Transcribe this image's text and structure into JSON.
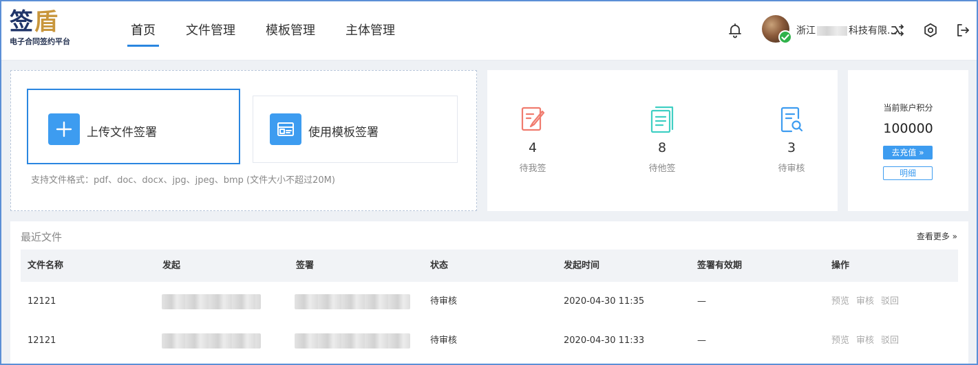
{
  "header": {
    "logo_main_1": "签",
    "logo_main_2": "盾",
    "logo_sub": "电子合同签约平台",
    "nav": [
      {
        "label": "首页",
        "active": true
      },
      {
        "label": "文件管理"
      },
      {
        "label": "模板管理"
      },
      {
        "label": "主体管理"
      }
    ],
    "company_prefix": "浙江",
    "company_suffix": "科技有限...",
    "icons": [
      "bell-icon",
      "switch-icon",
      "settings-icon",
      "logout-icon"
    ]
  },
  "upload": {
    "upload_label": "上传文件签署",
    "template_label": "使用模板签署",
    "hint": "支持文件格式：pdf、doc、docx、jpg、jpeg、bmp (文件大小不超过20M)"
  },
  "stats": [
    {
      "value": "4",
      "label": "待我签",
      "color": "#f07b6e"
    },
    {
      "value": "8",
      "label": "待他签",
      "color": "#3fcfc3"
    },
    {
      "value": "3",
      "label": "待审核",
      "color": "#3d9cf0"
    }
  ],
  "points": {
    "title": "当前账户积分",
    "value": "100000",
    "recharge_label": "去充值 »",
    "detail_label": "明细"
  },
  "recent": {
    "title": "最近文件",
    "more_label": "查看更多 »",
    "columns": [
      "文件名称",
      "发起",
      "签署",
      "状态",
      "发起时间",
      "签署有效期",
      "操作"
    ],
    "rows": [
      {
        "name": "12121",
        "status": "待审核",
        "time": "2020-04-30 11:35",
        "validity": "—",
        "ops": [
          "预览",
          "审核",
          "驳回"
        ]
      },
      {
        "name": "12121",
        "status": "待审核",
        "time": "2020-04-30 11:33",
        "validity": "—",
        "ops": [
          "预览",
          "审核",
          "驳回"
        ]
      }
    ]
  },
  "colors": {
    "accent": "#2a86e0",
    "button_blue": "#3d9cf0",
    "brand_navy": "#1f3468",
    "brand_gold": "#c8963c",
    "verified_green": "#2fb24a"
  }
}
